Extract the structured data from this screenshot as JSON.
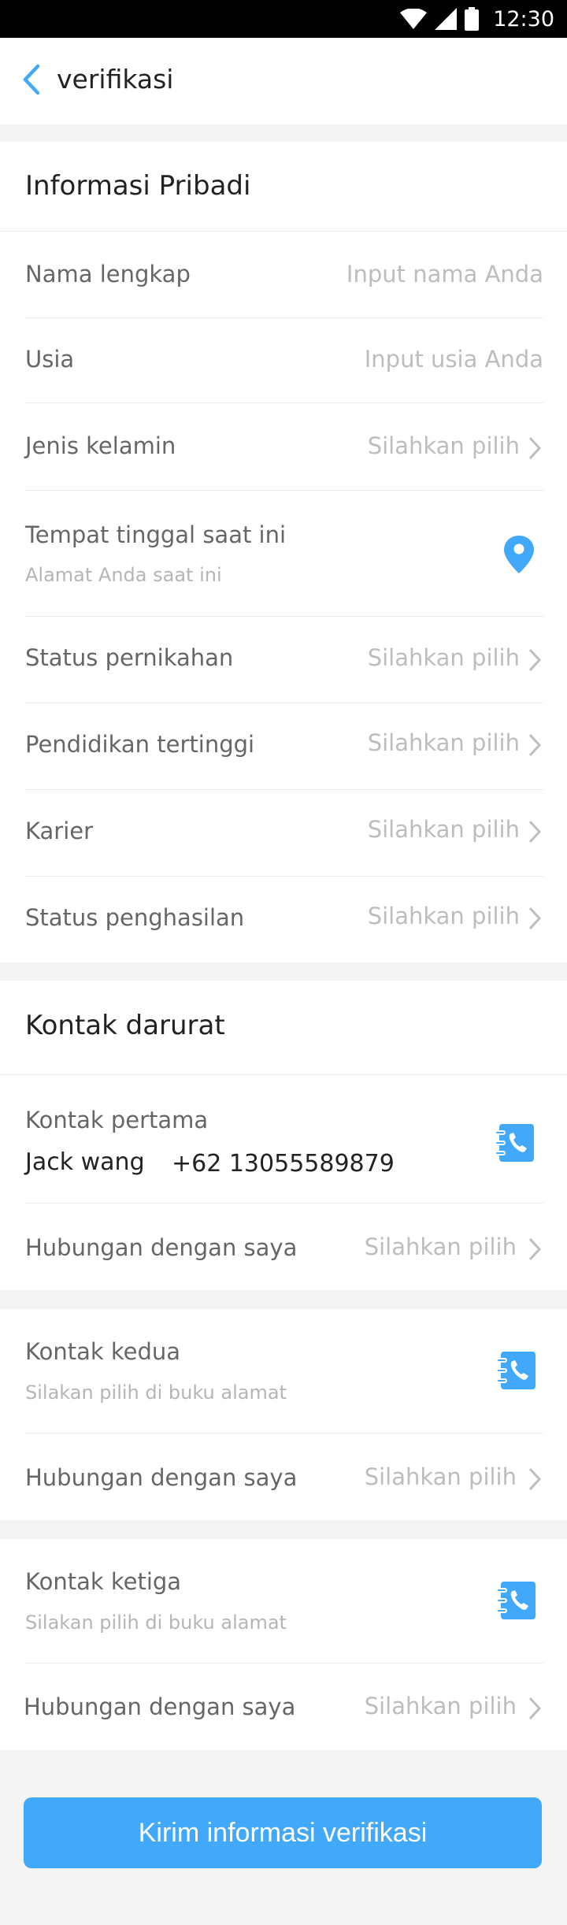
{
  "statusbar": {
    "time": "12:30"
  },
  "header": {
    "title": "verifikasi"
  },
  "personal": {
    "title": "Informasi Pribadi",
    "rows": [
      {
        "label": "Nama lengkap",
        "value": "Input nama Anda"
      },
      {
        "label": "Usia",
        "value": "Input usia Anda"
      },
      {
        "label": "Jenis kelamin",
        "value": "Silahkan pilih"
      },
      {
        "label": "Tempat tinggal saat ini",
        "sub": "Alamat Anda saat ini"
      },
      {
        "label": "Status pernikahan",
        "value": "Silahkan pilih"
      },
      {
        "label": "Pendidikan tertinggi",
        "value": "Silahkan pilih"
      },
      {
        "label": "Karier",
        "value": "Silahkan pilih"
      },
      {
        "label": "Status penghasilan",
        "value": "Silahkan pilih"
      }
    ]
  },
  "emergency": {
    "title": "Kontak darurat",
    "contact1": {
      "label": "Kontak pertama",
      "name": "Jack wang",
      "phone": "+62 13055589879",
      "relation_label": "Hubungan dengan saya",
      "relation_value": "Silahkan pilih"
    },
    "contact2": {
      "label": "Kontak kedua",
      "sub": "Silakan pilih di buku alamat",
      "relation_label": "Hubungan dengan saya",
      "relation_value": "Silahkan pilih"
    },
    "contact3": {
      "label": "Kontak ketiga",
      "sub": "Silakan pilih di buku alamat",
      "relation_label": "Hubungan dengan saya",
      "relation_value": "Silahkan pilih"
    }
  },
  "submit_label": "Kirim informasi verifikasi",
  "colors": {
    "accent": "#42a8fa",
    "status_bar": "#000000",
    "background": "#f4f4f4"
  },
  "icons": [
    "wifi-icon",
    "signal-icon",
    "battery-icon",
    "back-arrow-icon",
    "chevron-right-icon",
    "location-pin-icon",
    "address-book-icon"
  ]
}
